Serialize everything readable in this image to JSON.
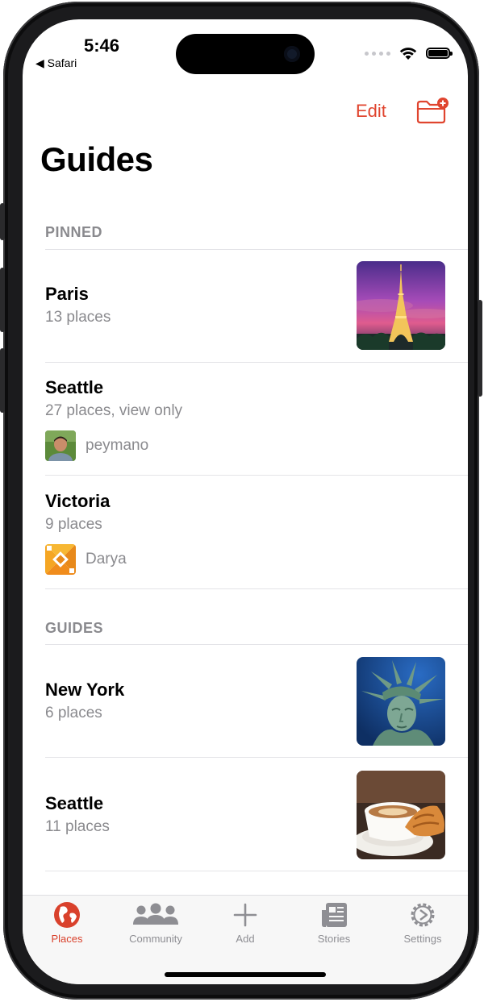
{
  "status": {
    "time": "5:46",
    "back_app": "◀ Safari"
  },
  "toolbar": {
    "edit_label": "Edit",
    "new_folder_icon": "folder-plus-icon"
  },
  "page_title": "Guides",
  "sections": {
    "pinned": {
      "header": "PINNED",
      "items": [
        {
          "name": "Paris",
          "subtitle": "13 places",
          "thumb": "eiffel-tower-photo"
        },
        {
          "name": "Seattle",
          "subtitle": "27 places, view only",
          "owner": "peymano"
        },
        {
          "name": "Victoria",
          "subtitle": "9 places",
          "owner": "Darya"
        }
      ]
    },
    "guides": {
      "header": "GUIDES",
      "items": [
        {
          "name": "New York",
          "subtitle": "6 places",
          "thumb": "statue-of-liberty-photo"
        },
        {
          "name": "Seattle",
          "subtitle": "11 places",
          "thumb": "coffee-croissant-photo"
        }
      ]
    }
  },
  "tabs": [
    {
      "label": "Places",
      "icon": "globe-icon",
      "active": true
    },
    {
      "label": "Community",
      "icon": "people-icon",
      "active": false
    },
    {
      "label": "Add",
      "icon": "plus-icon",
      "active": false
    },
    {
      "label": "Stories",
      "icon": "newspaper-icon",
      "active": false
    },
    {
      "label": "Settings",
      "icon": "gear-icon",
      "active": false
    }
  ],
  "colors": {
    "accent": "#e0452f",
    "secondary_text": "#8a8a8e",
    "tab_inactive": "#8e8e93"
  }
}
